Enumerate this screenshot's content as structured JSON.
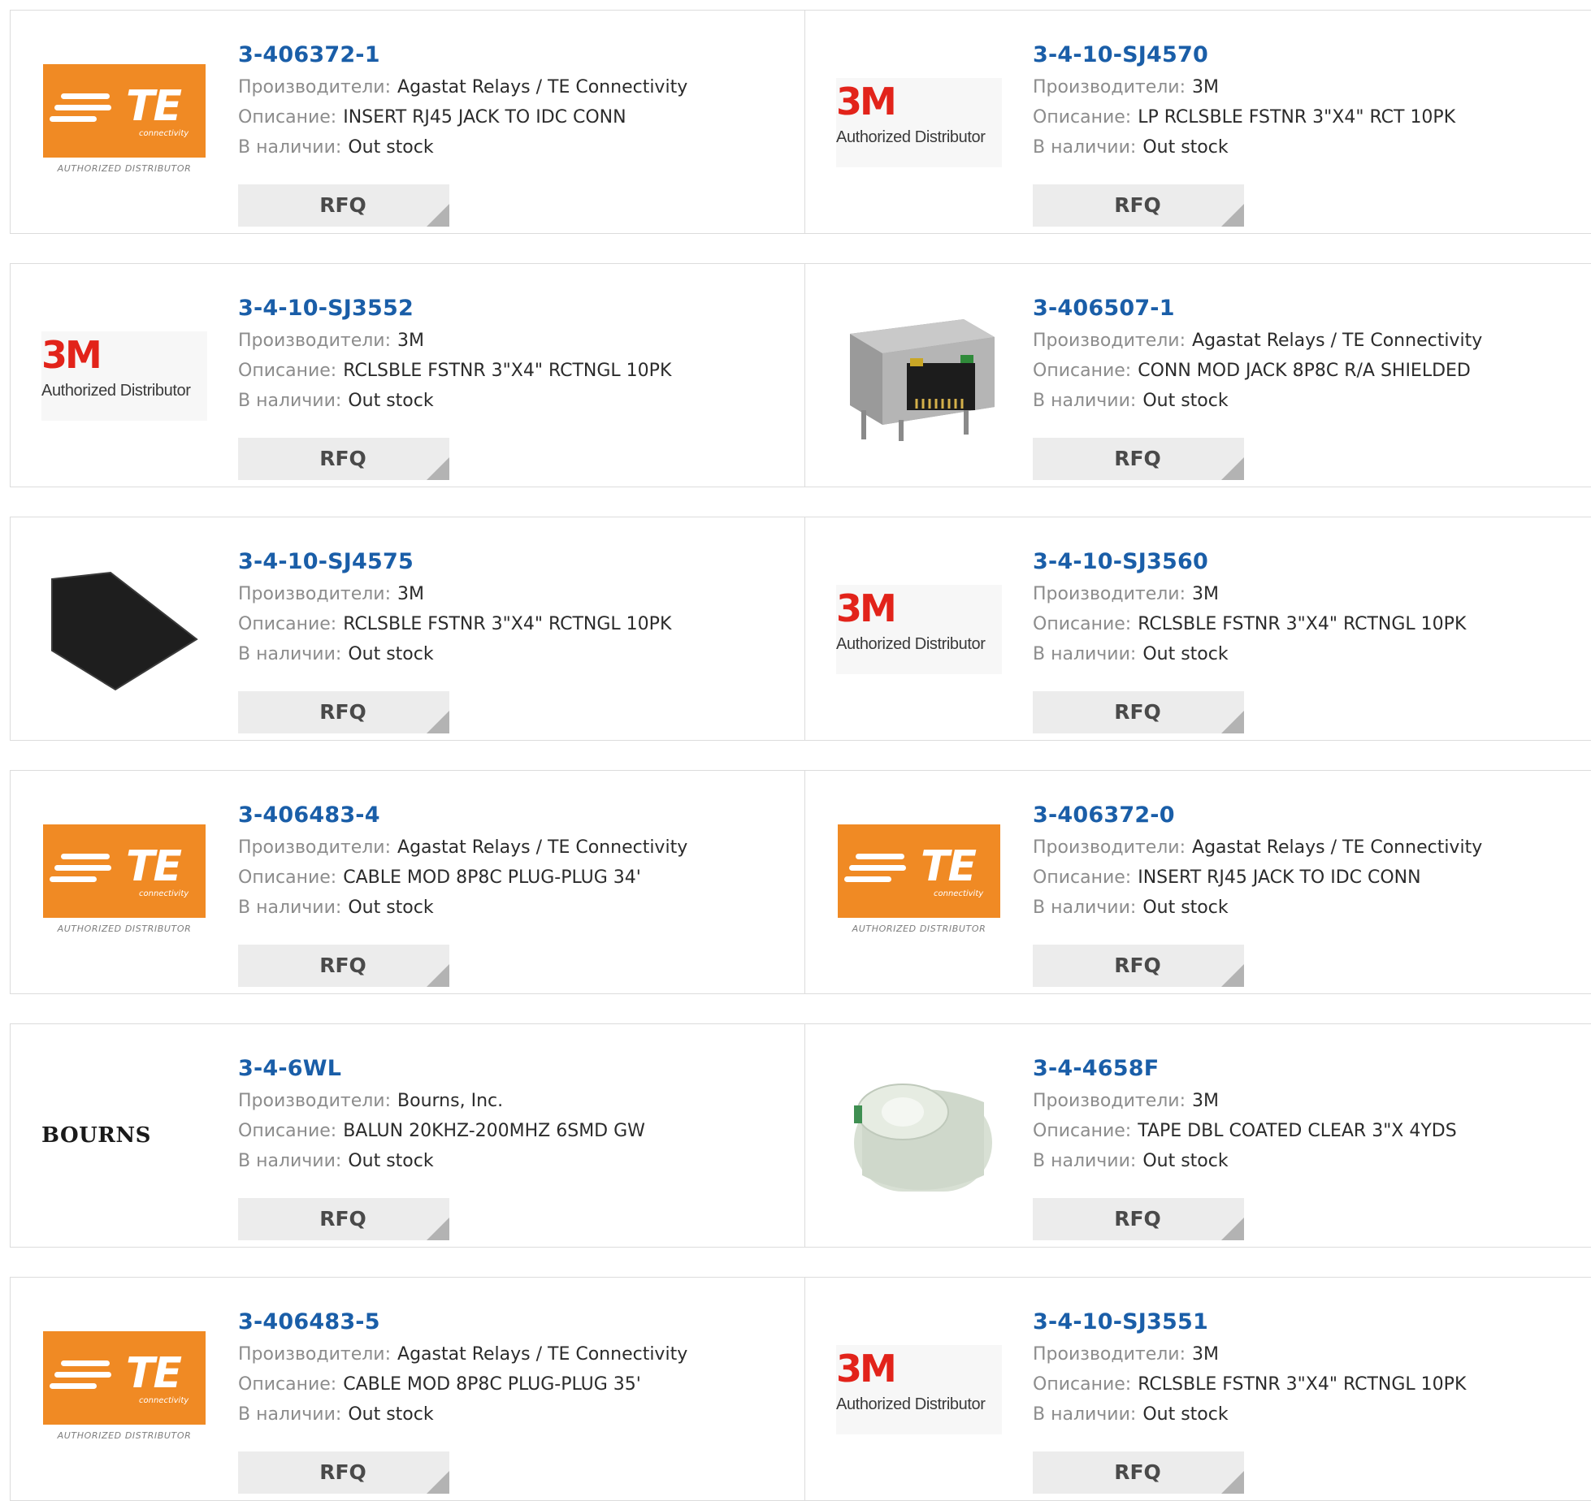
{
  "labels": {
    "manufacturer": "Производители:",
    "description": "Описание:",
    "stock": "В наличии:",
    "rfq": "RFQ"
  },
  "logo_text": {
    "te_wordmark": "TE",
    "te_sub": "connectivity",
    "te_authorized": "AUTHORIZED DISTRIBUTOR",
    "mm_wordmark": "3M",
    "mm_authorized": "Authorized Distributor",
    "bourns_wordmark": "BOURNS"
  },
  "colors": {
    "part_link": "#1a5ea8",
    "te_orange": "#f08a24",
    "mm_red": "#e2231a",
    "rfq_bg": "#ececec"
  },
  "products": [
    {
      "part": "3-406372-1",
      "manufacturer": "Agastat Relays / TE Connectivity",
      "description": "INSERT RJ45 JACK TO IDC CONN",
      "stock": "Out stock",
      "image": "te-logo"
    },
    {
      "part": "3-4-10-SJ4570",
      "manufacturer": "3M",
      "description": "LP RCLSBLE FSTNR 3\"X4\" RCT 10PK",
      "stock": "Out stock",
      "image": "3m-logo"
    },
    {
      "part": "3-4-10-SJ3552",
      "manufacturer": "3M",
      "description": "RCLSBLE FSTNR 3\"X4\" RCTNGL 10PK",
      "stock": "Out stock",
      "image": "3m-logo"
    },
    {
      "part": "3-406507-1",
      "manufacturer": "Agastat Relays / TE Connectivity",
      "description": "CONN MOD JACK 8P8C R/A SHIELDED",
      "stock": "Out stock",
      "image": "rj45-jack-photo"
    },
    {
      "part": "3-4-10-SJ4575",
      "manufacturer": "3M",
      "description": "RCLSBLE FSTNR 3\"X4\" RCTNGL 10PK",
      "stock": "Out stock",
      "image": "fastener-strip-photo"
    },
    {
      "part": "3-4-10-SJ3560",
      "manufacturer": "3M",
      "description": "RCLSBLE FSTNR 3\"X4\" RCTNGL 10PK",
      "stock": "Out stock",
      "image": "3m-logo"
    },
    {
      "part": "3-406483-4",
      "manufacturer": "Agastat Relays / TE Connectivity",
      "description": "CABLE MOD 8P8C PLUG-PLUG 34'",
      "stock": "Out stock",
      "image": "te-logo"
    },
    {
      "part": "3-406372-0",
      "manufacturer": "Agastat Relays / TE Connectivity",
      "description": "INSERT RJ45 JACK TO IDC CONN",
      "stock": "Out stock",
      "image": "te-logo"
    },
    {
      "part": "3-4-6WL",
      "manufacturer": "Bourns, Inc.",
      "description": "BALUN 20KHZ-200MHZ 6SMD GW",
      "stock": "Out stock",
      "image": "bourns-logo"
    },
    {
      "part": "3-4-4658F",
      "manufacturer": "3M",
      "description": "TAPE DBL COATED CLEAR 3\"X 4YDS",
      "stock": "Out stock",
      "image": "tape-roll-photo"
    },
    {
      "part": "3-406483-5",
      "manufacturer": "Agastat Relays / TE Connectivity",
      "description": "CABLE MOD 8P8C PLUG-PLUG 35'",
      "stock": "Out stock",
      "image": "te-logo"
    },
    {
      "part": "3-4-10-SJ3551",
      "manufacturer": "3M",
      "description": "RCLSBLE FSTNR 3\"X4\" RCTNGL 10PK",
      "stock": "Out stock",
      "image": "3m-logo"
    }
  ]
}
